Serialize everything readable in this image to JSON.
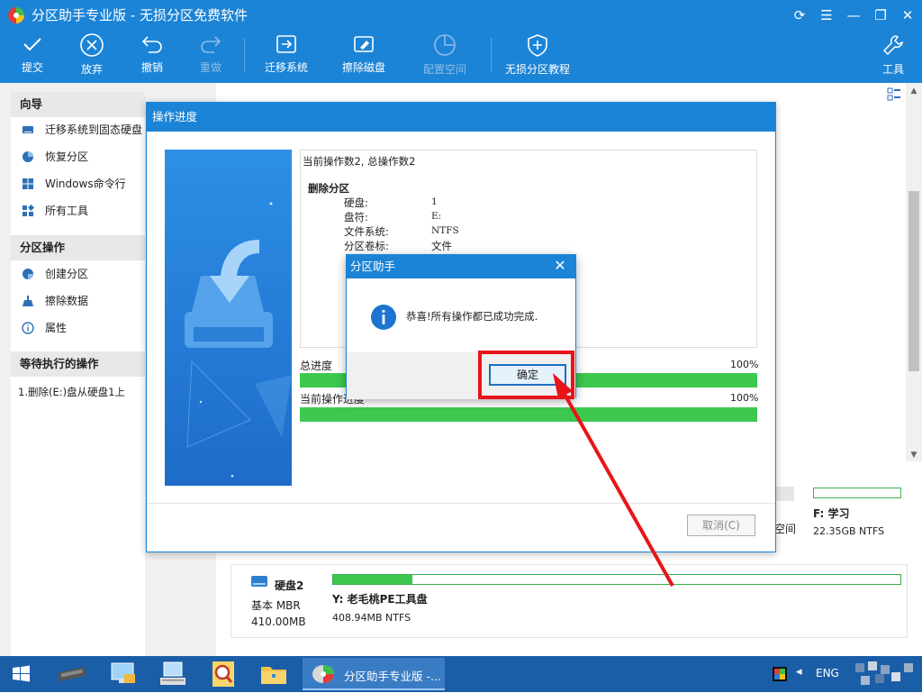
{
  "window": {
    "title": "分区助手专业版 - 无损分区免费软件"
  },
  "toolbar": {
    "items": [
      {
        "label": "提交",
        "icon": "check-icon",
        "enabled": true
      },
      {
        "label": "放弃",
        "icon": "circle-x-icon",
        "enabled": true
      },
      {
        "label": "撤销",
        "icon": "undo-icon",
        "enabled": true
      },
      {
        "label": "重做",
        "icon": "redo-icon",
        "enabled": false
      },
      {
        "label": "迁移系统",
        "icon": "migrate-icon",
        "enabled": true
      },
      {
        "label": "擦除磁盘",
        "icon": "wipe-disk-icon",
        "enabled": true
      },
      {
        "label": "配置空间",
        "icon": "clock-pie-icon",
        "enabled": false
      },
      {
        "label": "无损分区教程",
        "icon": "shield-plus-icon",
        "enabled": true
      }
    ],
    "tools_label": "工具"
  },
  "sidebar": {
    "wizard": {
      "title": "向导",
      "items": [
        {
          "label": "迁移系统到固态硬盘",
          "icon": "ssd-migrate-icon"
        },
        {
          "label": "恢复分区",
          "icon": "pie-restore-icon"
        },
        {
          "label": "Windows命令行",
          "icon": "windows-icon"
        },
        {
          "label": "所有工具",
          "icon": "tools-grid-icon"
        }
      ]
    },
    "partition_ops": {
      "title": "分区操作",
      "items": [
        {
          "label": "创建分区",
          "icon": "create-partition-icon"
        },
        {
          "label": "擦除数据",
          "icon": "broom-icon"
        },
        {
          "label": "属性",
          "icon": "info-icon"
        }
      ]
    },
    "pending": {
      "title": "等待执行的操作",
      "items": [
        "1.删除(E:)盘从硬盘1上"
      ]
    }
  },
  "disk_view": {
    "partial_label": "空间",
    "partition_f": {
      "name": "F: 学习",
      "size": "22.35GB NTFS"
    },
    "disk2": {
      "name": "硬盘2",
      "type": "基本 MBR",
      "capacity": "410.00MB",
      "partition": {
        "name": "Y: 老毛桃PE工具盘",
        "size": "408.94MB NTFS",
        "used_fraction": 0.14
      }
    }
  },
  "progress_dialog": {
    "title": "操作进度",
    "log": {
      "header": "当前操作数2, 总操作数2",
      "op_title": "删除分区",
      "fields": [
        {
          "label": "硬盘:",
          "value": "1"
        },
        {
          "label": "盘符:",
          "value": "E:"
        },
        {
          "label": "文件系统:",
          "value": "NTFS"
        },
        {
          "label": "分区卷标:",
          "value": "文件"
        }
      ]
    },
    "total_label": "总进度",
    "total_pct": "100%",
    "total_value": 1.0,
    "current_label": "当前操作进度",
    "current_pct": "100%",
    "current_value": 1.0,
    "cancel_label": "取消(C)"
  },
  "message_box": {
    "title": "分区助手",
    "text": "恭喜!所有操作都已成功完成.",
    "ok_label": "确定"
  },
  "taskbar": {
    "active_label": "分区助手专业版 -...",
    "lang": "ENG"
  },
  "colors": {
    "brand_blue": "#1c84d6",
    "progress_green": "#3cc84e",
    "annotation_red": "#e8141a"
  }
}
